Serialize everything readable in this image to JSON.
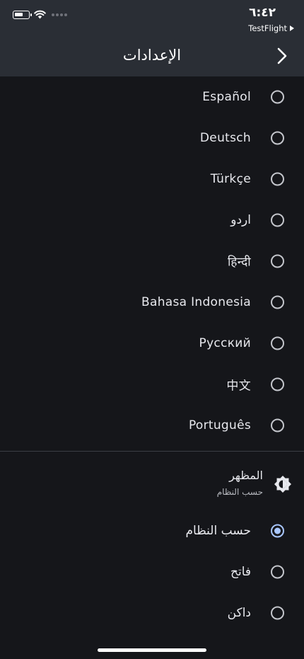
{
  "status_bar": {
    "time": "٦:٤٢",
    "testflight_label": "TestFlight",
    "icons": [
      "battery-icon",
      "wifi-icon",
      "cellular-dots-icon",
      "play-icon"
    ]
  },
  "header": {
    "title": "الإعدادات",
    "back_icon": "chevron-right-icon"
  },
  "languages": [
    {
      "label": "Español",
      "selected": false
    },
    {
      "label": "Deutsch",
      "selected": false
    },
    {
      "label": "Türkçe",
      "selected": false
    },
    {
      "label": "اردو",
      "selected": false
    },
    {
      "label": "हिन्दी",
      "selected": false
    },
    {
      "label": "Bahasa Indonesia",
      "selected": false
    },
    {
      "label": "Русский",
      "selected": false
    },
    {
      "label": "中文",
      "selected": false
    },
    {
      "label": "Português",
      "selected": false
    }
  ],
  "appearance": {
    "title": "المظهر",
    "subtitle": "حسب النظام",
    "icon": "brightness-icon",
    "options": [
      {
        "label": "حسب النظام",
        "selected": true
      },
      {
        "label": "فاتح",
        "selected": false
      },
      {
        "label": "داكن",
        "selected": false
      }
    ]
  },
  "colors": {
    "background": "#15161a",
    "bar": "#2a2e35",
    "accent": "#a9c7ff"
  }
}
